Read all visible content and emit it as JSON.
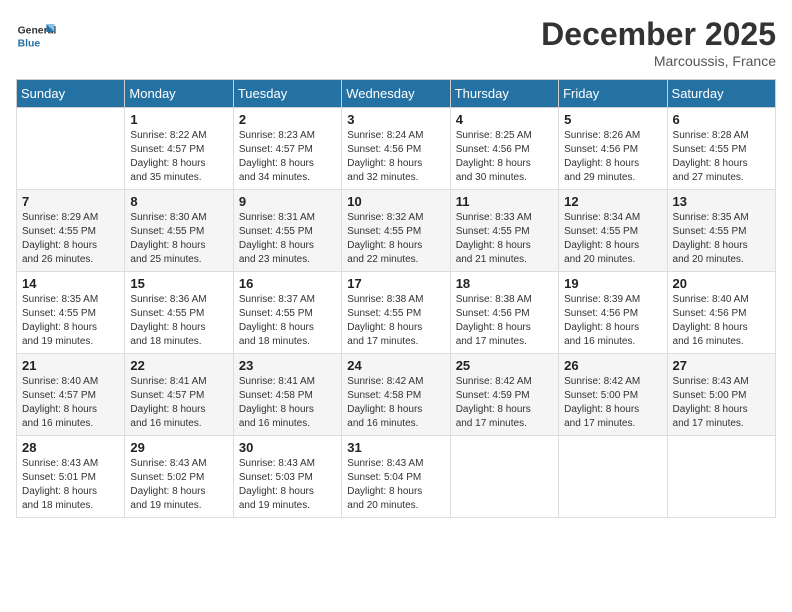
{
  "header": {
    "logo_general": "General",
    "logo_blue": "Blue",
    "month_title": "December 2025",
    "location": "Marcoussis, France"
  },
  "columns": [
    "Sunday",
    "Monday",
    "Tuesday",
    "Wednesday",
    "Thursday",
    "Friday",
    "Saturday"
  ],
  "weeks": [
    [
      {
        "day": "",
        "sunrise": "",
        "sunset": "",
        "daylight": ""
      },
      {
        "day": "1",
        "sunrise": "Sunrise: 8:22 AM",
        "sunset": "Sunset: 4:57 PM",
        "daylight": "Daylight: 8 hours and 35 minutes."
      },
      {
        "day": "2",
        "sunrise": "Sunrise: 8:23 AM",
        "sunset": "Sunset: 4:57 PM",
        "daylight": "Daylight: 8 hours and 34 minutes."
      },
      {
        "day": "3",
        "sunrise": "Sunrise: 8:24 AM",
        "sunset": "Sunset: 4:56 PM",
        "daylight": "Daylight: 8 hours and 32 minutes."
      },
      {
        "day": "4",
        "sunrise": "Sunrise: 8:25 AM",
        "sunset": "Sunset: 4:56 PM",
        "daylight": "Daylight: 8 hours and 30 minutes."
      },
      {
        "day": "5",
        "sunrise": "Sunrise: 8:26 AM",
        "sunset": "Sunset: 4:56 PM",
        "daylight": "Daylight: 8 hours and 29 minutes."
      },
      {
        "day": "6",
        "sunrise": "Sunrise: 8:28 AM",
        "sunset": "Sunset: 4:55 PM",
        "daylight": "Daylight: 8 hours and 27 minutes."
      }
    ],
    [
      {
        "day": "7",
        "sunrise": "Sunrise: 8:29 AM",
        "sunset": "Sunset: 4:55 PM",
        "daylight": "Daylight: 8 hours and 26 minutes."
      },
      {
        "day": "8",
        "sunrise": "Sunrise: 8:30 AM",
        "sunset": "Sunset: 4:55 PM",
        "daylight": "Daylight: 8 hours and 25 minutes."
      },
      {
        "day": "9",
        "sunrise": "Sunrise: 8:31 AM",
        "sunset": "Sunset: 4:55 PM",
        "daylight": "Daylight: 8 hours and 23 minutes."
      },
      {
        "day": "10",
        "sunrise": "Sunrise: 8:32 AM",
        "sunset": "Sunset: 4:55 PM",
        "daylight": "Daylight: 8 hours and 22 minutes."
      },
      {
        "day": "11",
        "sunrise": "Sunrise: 8:33 AM",
        "sunset": "Sunset: 4:55 PM",
        "daylight": "Daylight: 8 hours and 21 minutes."
      },
      {
        "day": "12",
        "sunrise": "Sunrise: 8:34 AM",
        "sunset": "Sunset: 4:55 PM",
        "daylight": "Daylight: 8 hours and 20 minutes."
      },
      {
        "day": "13",
        "sunrise": "Sunrise: 8:35 AM",
        "sunset": "Sunset: 4:55 PM",
        "daylight": "Daylight: 8 hours and 20 minutes."
      }
    ],
    [
      {
        "day": "14",
        "sunrise": "Sunrise: 8:35 AM",
        "sunset": "Sunset: 4:55 PM",
        "daylight": "Daylight: 8 hours and 19 minutes."
      },
      {
        "day": "15",
        "sunrise": "Sunrise: 8:36 AM",
        "sunset": "Sunset: 4:55 PM",
        "daylight": "Daylight: 8 hours and 18 minutes."
      },
      {
        "day": "16",
        "sunrise": "Sunrise: 8:37 AM",
        "sunset": "Sunset: 4:55 PM",
        "daylight": "Daylight: 8 hours and 18 minutes."
      },
      {
        "day": "17",
        "sunrise": "Sunrise: 8:38 AM",
        "sunset": "Sunset: 4:55 PM",
        "daylight": "Daylight: 8 hours and 17 minutes."
      },
      {
        "day": "18",
        "sunrise": "Sunrise: 8:38 AM",
        "sunset": "Sunset: 4:56 PM",
        "daylight": "Daylight: 8 hours and 17 minutes."
      },
      {
        "day": "19",
        "sunrise": "Sunrise: 8:39 AM",
        "sunset": "Sunset: 4:56 PM",
        "daylight": "Daylight: 8 hours and 16 minutes."
      },
      {
        "day": "20",
        "sunrise": "Sunrise: 8:40 AM",
        "sunset": "Sunset: 4:56 PM",
        "daylight": "Daylight: 8 hours and 16 minutes."
      }
    ],
    [
      {
        "day": "21",
        "sunrise": "Sunrise: 8:40 AM",
        "sunset": "Sunset: 4:57 PM",
        "daylight": "Daylight: 8 hours and 16 minutes."
      },
      {
        "day": "22",
        "sunrise": "Sunrise: 8:41 AM",
        "sunset": "Sunset: 4:57 PM",
        "daylight": "Daylight: 8 hours and 16 minutes."
      },
      {
        "day": "23",
        "sunrise": "Sunrise: 8:41 AM",
        "sunset": "Sunset: 4:58 PM",
        "daylight": "Daylight: 8 hours and 16 minutes."
      },
      {
        "day": "24",
        "sunrise": "Sunrise: 8:42 AM",
        "sunset": "Sunset: 4:58 PM",
        "daylight": "Daylight: 8 hours and 16 minutes."
      },
      {
        "day": "25",
        "sunrise": "Sunrise: 8:42 AM",
        "sunset": "Sunset: 4:59 PM",
        "daylight": "Daylight: 8 hours and 17 minutes."
      },
      {
        "day": "26",
        "sunrise": "Sunrise: 8:42 AM",
        "sunset": "Sunset: 5:00 PM",
        "daylight": "Daylight: 8 hours and 17 minutes."
      },
      {
        "day": "27",
        "sunrise": "Sunrise: 8:43 AM",
        "sunset": "Sunset: 5:00 PM",
        "daylight": "Daylight: 8 hours and 17 minutes."
      }
    ],
    [
      {
        "day": "28",
        "sunrise": "Sunrise: 8:43 AM",
        "sunset": "Sunset: 5:01 PM",
        "daylight": "Daylight: 8 hours and 18 minutes."
      },
      {
        "day": "29",
        "sunrise": "Sunrise: 8:43 AM",
        "sunset": "Sunset: 5:02 PM",
        "daylight": "Daylight: 8 hours and 19 minutes."
      },
      {
        "day": "30",
        "sunrise": "Sunrise: 8:43 AM",
        "sunset": "Sunset: 5:03 PM",
        "daylight": "Daylight: 8 hours and 19 minutes."
      },
      {
        "day": "31",
        "sunrise": "Sunrise: 8:43 AM",
        "sunset": "Sunset: 5:04 PM",
        "daylight": "Daylight: 8 hours and 20 minutes."
      },
      {
        "day": "",
        "sunrise": "",
        "sunset": "",
        "daylight": ""
      },
      {
        "day": "",
        "sunrise": "",
        "sunset": "",
        "daylight": ""
      },
      {
        "day": "",
        "sunrise": "",
        "sunset": "",
        "daylight": ""
      }
    ]
  ]
}
